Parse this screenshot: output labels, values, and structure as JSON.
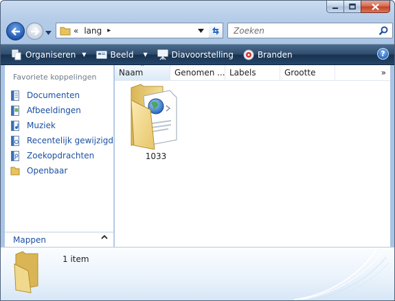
{
  "window": {
    "caption_buttons": {
      "minimize": "minimize-icon",
      "maximize": "maximize-icon",
      "close": "close-icon"
    }
  },
  "navigation": {
    "address": {
      "prefix": "«",
      "path": "lang",
      "separator": "▸"
    },
    "search": {
      "placeholder": "Zoeken"
    }
  },
  "toolbar": {
    "items": [
      {
        "label": "Organiseren",
        "icon": "organize-icon",
        "has_dropdown": true
      },
      {
        "label": "Beeld",
        "icon": "views-icon",
        "has_dropdown": true
      },
      {
        "label": "Diavoorstelling",
        "icon": "slideshow-icon",
        "has_dropdown": false
      },
      {
        "label": "Branden",
        "icon": "burn-icon",
        "has_dropdown": false
      }
    ],
    "help": "?"
  },
  "sidebar": {
    "title": "Favoriete koppelingen",
    "items": [
      {
        "label": "Documenten",
        "icon": "documents-icon"
      },
      {
        "label": "Afbeeldingen",
        "icon": "pictures-icon"
      },
      {
        "label": "Muziek",
        "icon": "music-icon"
      },
      {
        "label": "Recentelijk gewijzigd",
        "icon": "recent-icon"
      },
      {
        "label": "Zoekopdrachten",
        "icon": "searches-icon"
      },
      {
        "label": "Openbaar",
        "icon": "public-folder-icon"
      }
    ],
    "folders_label": "Mappen"
  },
  "file_list": {
    "columns": [
      "Naam",
      "Genomen ...",
      "Labels",
      "Grootte"
    ],
    "more": "»",
    "items": [
      {
        "name": "1033",
        "type": "folder"
      }
    ]
  },
  "details": {
    "item_count": "1 item"
  },
  "colors": {
    "accent": "#1a4fa2",
    "toolbar": "#23466a"
  }
}
